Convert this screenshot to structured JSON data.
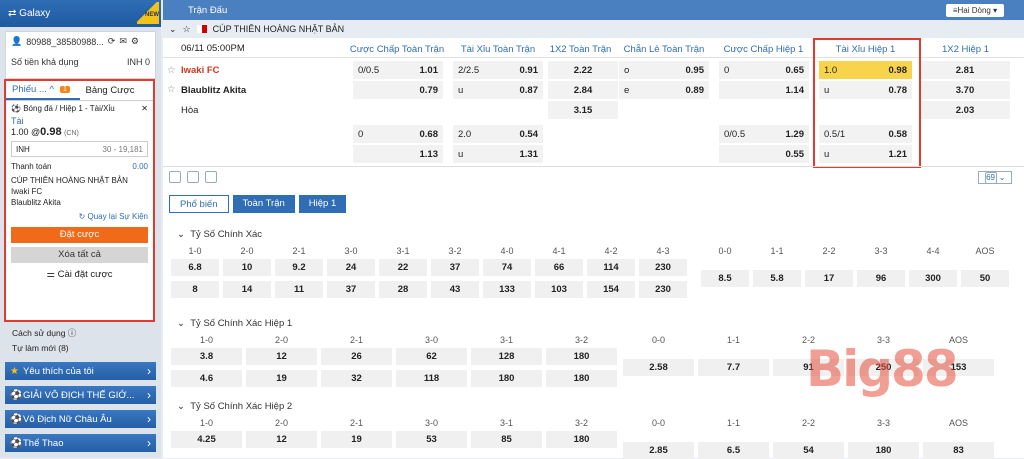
{
  "sidebar": {
    "site": "Galaxy",
    "badge": "NEW",
    "account": "80988_38580988...",
    "balance_label": "Số tiền khả dụng",
    "balance_value": "INH 0",
    "slip_tab": "Phiếu ...",
    "slip_count": "1",
    "board_tab": "Bảng Cược",
    "bet_title": "Bóng đá / Hiệp 1 - Tài/Xỉu",
    "bet_sel": "Tài",
    "bet_line": "1.00 @",
    "bet_odds": "0.98",
    "bet_cn": "(CN)",
    "currency": "INH",
    "limit": "30 - 19,181",
    "pay_label": "Thanh toán",
    "pay_value": "0.00",
    "league": "CÚP THIÊN HOÀNG NHẬT BẢN",
    "home": "Iwaki FC",
    "away": "Blaublitz Akita",
    "reset": "Quay lại Sự Kiện",
    "place": "Đặt cược",
    "clear": "Xóa tất cả",
    "settings": "Cài đặt cược",
    "howto": "Cách sử dụng",
    "recent": "Tự làm mới",
    "recent_count": "(8)",
    "menu": [
      "Yêu thích của tôi",
      "GIẢI VÔ ĐỊCH THẾ GIỚ...",
      "Vô Địch Nữ Châu Âu",
      "Thể Thao"
    ]
  },
  "main": {
    "title": "Trận Đấu",
    "view": "Hai Dòng",
    "league": "CÚP THIÊN HOÀNG NHẬT BẢN",
    "datetime": "06/11 05:00PM",
    "cols": [
      "Cược Chấp Toàn Trận",
      "Tài Xỉu Toàn Trận",
      "1X2 Toàn Trận",
      "Chẵn Lẻ Toàn Trận",
      "Cược Chấp Hiệp 1",
      "Tài Xỉu Hiệp 1",
      "1X2 Hiệp 1"
    ],
    "home": "Iwaki FC",
    "away": "Blaublitz Akita",
    "draw": "Hòa",
    "more": "69",
    "tabs": [
      "Phổ biến",
      "Toàn Trận",
      "Hiệp 1"
    ],
    "r1": {
      "hcp": "0/0.5",
      "hcp_o": "1.01",
      "ou": "2/2.5",
      "ou_o": "0.91",
      "x": "2.22",
      "oe": "o",
      "oe_o": "0.95",
      "h1": "0",
      "h1_o": "0.65",
      "t1": "1.0",
      "t1_o": "0.98",
      "x1": "2.81"
    },
    "r2": {
      "hcp_o": "0.79",
      "ou": "u",
      "ou_o": "0.87",
      "x": "2.84",
      "oe": "e",
      "oe_o": "0.89",
      "h1_o": "1.14",
      "t1": "u",
      "t1_o": "0.78",
      "x1": "3.70"
    },
    "r3": {
      "x": "3.15",
      "x1": "2.03"
    },
    "r4": {
      "hcp": "0",
      "hcp_o": "0.68",
      "ou": "2.0",
      "ou_o": "0.54",
      "h1": "0/0.5",
      "h1_o": "1.29",
      "t1": "0.5/1",
      "t1_o": "0.58"
    },
    "r5": {
      "hcp_o": "1.13",
      "ou": "u",
      "ou_o": "1.31",
      "h1_o": "0.55",
      "t1": "u",
      "t1_o": "1.21"
    },
    "s1": {
      "title": "Tỷ Số Chính Xác",
      "h": [
        "1-0",
        "2-0",
        "2-1",
        "3-0",
        "3-1",
        "3-2",
        "4-0",
        "4-1",
        "4-2",
        "4-3",
        "0-0",
        "1-1",
        "2-2",
        "3-3",
        "4-4",
        "AOS"
      ],
      "a": [
        "6.8",
        "10",
        "9.2",
        "24",
        "22",
        "37",
        "74",
        "66",
        "114",
        "230"
      ],
      "b": [
        "8",
        "14",
        "11",
        "37",
        "28",
        "43",
        "133",
        "103",
        "154",
        "230"
      ],
      "c": [
        "8.5",
        "5.8",
        "17",
        "96",
        "300",
        "50"
      ]
    },
    "s2": {
      "title": "Tỷ Số Chính Xác Hiệp 1",
      "h": [
        "1-0",
        "2-0",
        "2-1",
        "3-0",
        "3-1",
        "3-2",
        "0-0",
        "1-1",
        "2-2",
        "3-3",
        "AOS"
      ],
      "a": [
        "3.8",
        "12",
        "26",
        "62",
        "128",
        "180"
      ],
      "b": [
        "4.6",
        "19",
        "32",
        "118",
        "180",
        "180"
      ],
      "c": [
        "2.58",
        "7.7",
        "91",
        "250",
        "153"
      ]
    },
    "s3": {
      "title": "Tỷ Số Chính Xác Hiệp 2",
      "h": [
        "1-0",
        "2-0",
        "2-1",
        "3-0",
        "3-1",
        "3-2",
        "0-0",
        "1-1",
        "2-2",
        "3-3",
        "AOS"
      ],
      "a": [
        "4.25",
        "12",
        "19",
        "53",
        "85",
        "180"
      ],
      "c": [
        "2.85",
        "6.5",
        "54",
        "180",
        "83"
      ]
    },
    "watermark": "Big88"
  }
}
